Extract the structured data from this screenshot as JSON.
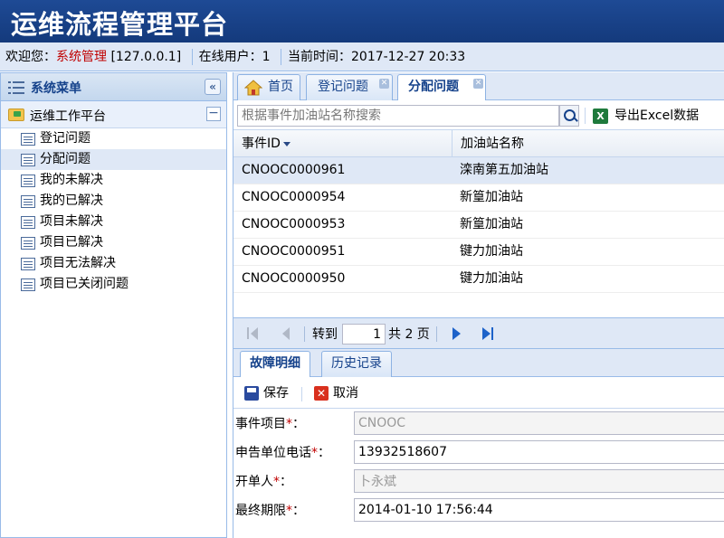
{
  "app": {
    "title": "运维流程管理平台"
  },
  "infobar": {
    "welcome": "欢迎您：",
    "user": "系统管理",
    "ip": "[127.0.0.1]",
    "online_label": "在线用户：",
    "online_count": "1",
    "time_label": "当前时间：",
    "time_value": "2017-12-27 20:33"
  },
  "sidebar": {
    "title": "系统菜单",
    "collapse_glyph": "«",
    "group": "运维工作平台",
    "group_toggle": "−",
    "items": [
      {
        "label": "登记问题"
      },
      {
        "label": "分配问题"
      },
      {
        "label": "我的未解决"
      },
      {
        "label": "我的已解决"
      },
      {
        "label": "项目未解决"
      },
      {
        "label": "项目已解决"
      },
      {
        "label": "项目无法解决"
      },
      {
        "label": "项目已关闭问题"
      }
    ]
  },
  "tabs": [
    {
      "label": "首页"
    },
    {
      "label": "登记问题"
    },
    {
      "label": "分配问题"
    }
  ],
  "toolbar": {
    "search_placeholder": "根据事件加油站名称搜索",
    "export_label": "导出Excel数据",
    "excel_glyph": "X"
  },
  "grid": {
    "columns": [
      "事件ID",
      "加油站名称"
    ],
    "rows": [
      {
        "id": "CNOOC0000961",
        "station": "滦南第五加油站"
      },
      {
        "id": "CNOOC0000954",
        "station": "新篁加油站"
      },
      {
        "id": "CNOOC0000953",
        "station": "新篁加油站"
      },
      {
        "id": "CNOOC0000951",
        "station": "键力加油站"
      },
      {
        "id": "CNOOC0000950",
        "station": "键力加油站"
      }
    ]
  },
  "pager": {
    "goto_label": "转到",
    "page": "1",
    "total_label": "共 2 页"
  },
  "detail_tabs": [
    {
      "label": "故障明细"
    },
    {
      "label": "历史记录"
    }
  ],
  "detail_toolbar": {
    "save_label": "保存",
    "cancel_label": "取消",
    "cancel_glyph": "✕"
  },
  "form": {
    "required_mark": "*",
    "fields": [
      {
        "label": "事件项目",
        "suffix": "：",
        "value": "CNOOC"
      },
      {
        "label": "申告单位电话",
        "suffix": "：",
        "value": "13932518607"
      },
      {
        "label": "开单人",
        "suffix": "：",
        "value": "卜永斌"
      },
      {
        "label": "最终期限",
        "suffix": "：",
        "value": "2014-01-10 17:56:44"
      }
    ]
  },
  "colors": {
    "title_bar": "#1e4a95",
    "panel_bg": "#dfe8f6",
    "border": "#99bbe8",
    "required": "#c00000"
  }
}
